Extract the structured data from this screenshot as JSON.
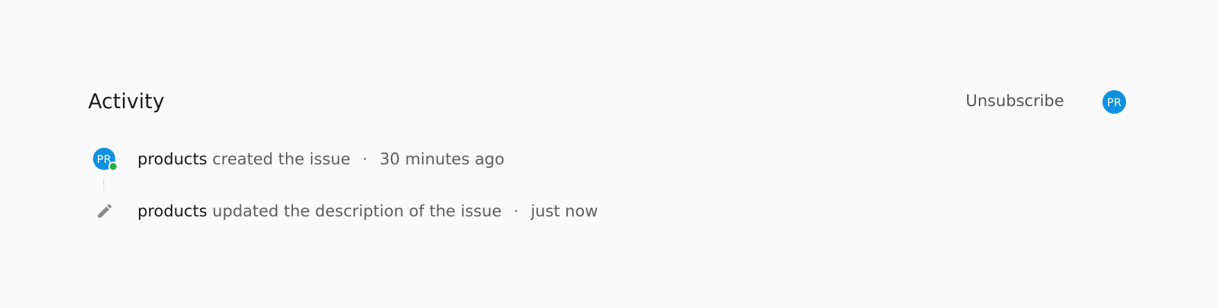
{
  "activity": {
    "title": "Activity",
    "unsubscribe_label": "Unsubscribe",
    "header_avatar_initials": "PR",
    "colors": {
      "accent": "#0f90e0",
      "online": "#24b24a",
      "text_primary": "#1a1a1a",
      "text_secondary": "#5e5e5e"
    },
    "events": [
      {
        "avatar_initials": "PR",
        "actor": "products",
        "action": "created the issue",
        "separator": "·",
        "time": "30 minutes ago",
        "icon": "avatar-icon"
      },
      {
        "actor": "products",
        "action": "updated the description of the issue",
        "separator": "·",
        "time": "just now",
        "icon": "pencil-icon"
      }
    ]
  }
}
